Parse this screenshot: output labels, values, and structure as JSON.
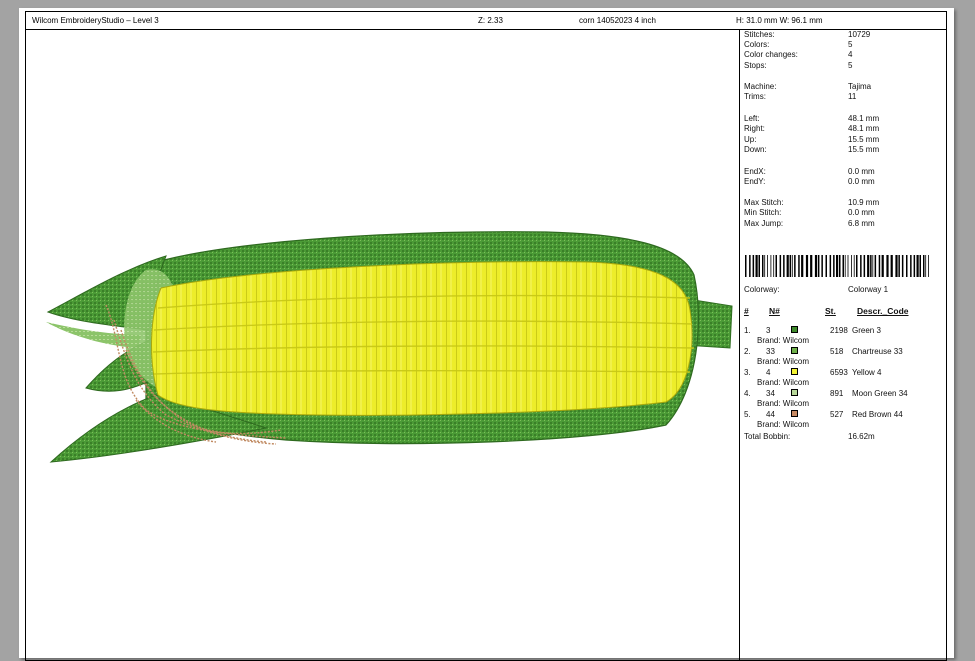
{
  "header": {
    "title": "Wilcom EmbroideryStudio – Level 3",
    "zoom": "Z: 2.33",
    "filename": "corn 14052023 4 inch",
    "size": "H: 31.0 mm   W: 96.1 mm"
  },
  "stats": [
    {
      "label": "Stitches:",
      "value": "10729"
    },
    {
      "label": "Colors:",
      "value": "5"
    },
    {
      "label": "Color changes:",
      "value": "4"
    },
    {
      "label": "Stops:",
      "value": "5"
    },
    {
      "label": "Machine:",
      "value": "Tajima"
    },
    {
      "label": "Trims:",
      "value": "11"
    },
    {
      "label": "Left:",
      "value": "48.1 mm"
    },
    {
      "label": "Right:",
      "value": "48.1 mm"
    },
    {
      "label": "Up:",
      "value": "15.5 mm"
    },
    {
      "label": "Down:",
      "value": "15.5 mm"
    },
    {
      "label": "EndX:",
      "value": "0.0 mm"
    },
    {
      "label": "EndY:",
      "value": "0.0 mm"
    },
    {
      "label": "Max Stitch:",
      "value": "10.9 mm"
    },
    {
      "label": "Min Stitch:",
      "value": "0.0 mm"
    },
    {
      "label": "Max Jump:",
      "value": "6.8 mm"
    }
  ],
  "colorway": {
    "label": "Colorway:",
    "value": "Colorway 1"
  },
  "table_headers": {
    "index": "#",
    "number": "N#",
    "stitches": "St.",
    "description": "Descr._Code"
  },
  "colors": [
    {
      "index": "1.",
      "number": "3",
      "hex": "#3f8a2c",
      "stitches": "2198",
      "description": "Green 3",
      "brand": "Brand: Wilcom"
    },
    {
      "index": "2.",
      "number": "33",
      "hex": "#6fb04a",
      "stitches": "518",
      "description": "Chartreuse 33",
      "brand": "Brand: Wilcom"
    },
    {
      "index": "3.",
      "number": "4",
      "hex": "#f2f233",
      "stitches": "6593",
      "description": "Yellow 4",
      "brand": "Brand: Wilcom"
    },
    {
      "index": "4.",
      "number": "34",
      "hex": "#b8d89a",
      "stitches": "891",
      "description": "Moon Green 34",
      "brand": "Brand: Wilcom"
    },
    {
      "index": "5.",
      "number": "44",
      "hex": "#c88a63",
      "stitches": "527",
      "description": "Red Brown 44",
      "brand": "Brand: Wilcom"
    }
  ],
  "bobbin": {
    "label": "Total Bobbin:",
    "value": "16.62m"
  }
}
